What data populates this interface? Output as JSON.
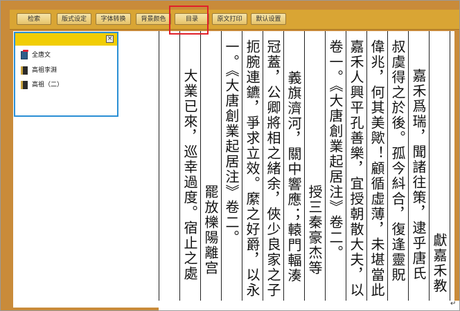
{
  "toolbar": {
    "buttons": [
      "检索",
      "版式设定",
      "字体转换",
      "背景颜色",
      "目录",
      "原文打印",
      "默认设置"
    ]
  },
  "catalog": {
    "close_label": "×",
    "items": [
      {
        "label": "全唐文",
        "icon": "book-stack-icon"
      },
      {
        "label": "高祖李淵",
        "icon": "book-icon"
      },
      {
        "label": "高祖（二）",
        "icon": "book-icon"
      }
    ]
  },
  "reader": {
    "columns": [
      "",
      "大業已來，巡幸過度。宿止之處",
      "罷放櫟陽離宫",
      "一。《大唐創業起居注》卷二。",
      "扼腕連鑣，爭求立效。縻之好爵，以永",
      "冠蓋，公卿將相之緒余，俠少良家之子",
      "義旗濟河，關中響應；轅門輻湊",
      "授三秦豪杰等",
      "卷一。《大唐創業起居注》卷二。",
      "嘉禾人興平孔善樂，宜授朝散大夫，以",
      "偉兆，何其美歟！顧循虛薄，未堪當此",
      "叔虞得之於後。孤今紏合，復逢靈貺",
      "嘉禾爲瑞，聞諸往策，逮乎唐氏",
      "獻嘉禾教",
      ""
    ]
  },
  "colors": {
    "toolbar": "#d9a534",
    "frame": "#c98b3a",
    "catalog_header": "#f1cd05",
    "highlight": "#e0202a",
    "panel_border": "#2a8fd4"
  }
}
